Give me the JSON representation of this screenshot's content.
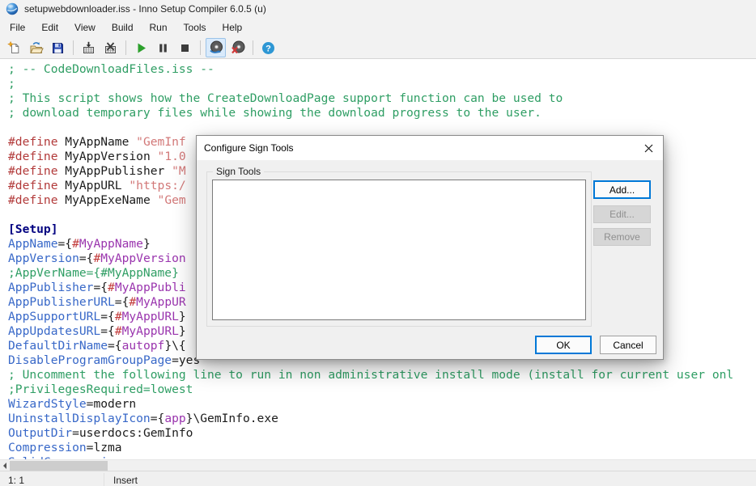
{
  "window": {
    "title": "setupwebdownloader.iss - Inno Setup Compiler 6.0.5 (u)",
    "app_icon": "inno-setup-sphere-icon"
  },
  "menubar": {
    "items": [
      "File",
      "Edit",
      "View",
      "Build",
      "Run",
      "Tools",
      "Help"
    ]
  },
  "toolbar": {
    "buttons": [
      {
        "name": "new-script",
        "icon": "new-file-icon",
        "active": false
      },
      {
        "name": "open-script",
        "icon": "open-folder-icon",
        "active": false
      },
      {
        "name": "save-script",
        "icon": "save-floppy-icon",
        "active": false
      },
      {
        "name": "compile",
        "icon": "compile-crate-icon",
        "active": false
      },
      {
        "name": "stop-compile",
        "icon": "crate-x-icon",
        "active": false
      },
      {
        "name": "run",
        "icon": "run-play-icon",
        "active": false
      },
      {
        "name": "pause",
        "icon": "pause-icon",
        "active": false
      },
      {
        "name": "terminate",
        "icon": "stop-square-icon",
        "active": false
      },
      {
        "name": "target-setup",
        "icon": "cd-arrow-icon",
        "active": true
      },
      {
        "name": "target-uninstall",
        "icon": "cd-x-icon",
        "active": false
      },
      {
        "name": "help",
        "icon": "help-question-icon",
        "active": false
      }
    ]
  },
  "editor": {
    "lines": [
      [
        [
          "cm",
          "; -- CodeDownloadFiles.iss --"
        ]
      ],
      [
        [
          "cm",
          ";"
        ]
      ],
      [
        [
          "cm",
          "; This script shows how the CreateDownloadPage support function can be used to"
        ]
      ],
      [
        [
          "cm",
          "; download temporary files while showing the download progress to the user."
        ]
      ],
      [],
      [
        [
          "dir",
          "#define"
        ],
        [
          "id",
          " MyAppName "
        ],
        [
          "str",
          "\"GemInf"
        ]
      ],
      [
        [
          "dir",
          "#define"
        ],
        [
          "id",
          " MyAppVersion "
        ],
        [
          "str",
          "\"1.0"
        ]
      ],
      [
        [
          "dir",
          "#define"
        ],
        [
          "id",
          " MyAppPublisher "
        ],
        [
          "str",
          "\"M"
        ]
      ],
      [
        [
          "dir",
          "#define"
        ],
        [
          "id",
          " MyAppURL "
        ],
        [
          "str",
          "\"https:/"
        ]
      ],
      [
        [
          "dir",
          "#define"
        ],
        [
          "id",
          " MyAppExeName "
        ],
        [
          "str",
          "\"Gem"
        ]
      ],
      [],
      [
        [
          "sec",
          "[Setup]"
        ]
      ],
      [
        [
          "kw",
          "AppName"
        ],
        [
          "sym",
          "={"
        ],
        [
          "hash",
          "#"
        ],
        [
          "const",
          "MyAppName"
        ],
        [
          "sym",
          "}"
        ]
      ],
      [
        [
          "kw",
          "AppVersion"
        ],
        [
          "sym",
          "={"
        ],
        [
          "hash",
          "#"
        ],
        [
          "const",
          "MyAppVersion"
        ]
      ],
      [
        [
          "cm",
          ";AppVerName={#MyAppName}"
        ]
      ],
      [
        [
          "kw",
          "AppPublisher"
        ],
        [
          "sym",
          "={"
        ],
        [
          "hash",
          "#"
        ],
        [
          "const",
          "MyAppPubli"
        ]
      ],
      [
        [
          "kw",
          "AppPublisherURL"
        ],
        [
          "sym",
          "={"
        ],
        [
          "hash",
          "#"
        ],
        [
          "const",
          "MyAppUR"
        ]
      ],
      [
        [
          "kw",
          "AppSupportURL"
        ],
        [
          "sym",
          "={"
        ],
        [
          "hash",
          "#"
        ],
        [
          "const",
          "MyAppURL"
        ],
        [
          "sym",
          "}"
        ]
      ],
      [
        [
          "kw",
          "AppUpdatesURL"
        ],
        [
          "sym",
          "={"
        ],
        [
          "hash",
          "#"
        ],
        [
          "const",
          "MyAppURL"
        ],
        [
          "sym",
          "}"
        ]
      ],
      [
        [
          "kw",
          "DefaultDirName"
        ],
        [
          "sym",
          "={"
        ],
        [
          "const",
          "autopf"
        ],
        [
          "sym",
          "}\\{"
        ]
      ],
      [
        [
          "kw",
          "DisableProgramGroupPage"
        ],
        [
          "sym",
          "="
        ],
        [
          "id",
          "yes"
        ]
      ],
      [
        [
          "cm",
          "; Uncomment the following line to run in non administrative install mode (install for current user onl"
        ]
      ],
      [
        [
          "cm",
          ";PrivilegesRequired=lowest"
        ]
      ],
      [
        [
          "kw",
          "WizardStyle"
        ],
        [
          "sym",
          "="
        ],
        [
          "id",
          "modern"
        ]
      ],
      [
        [
          "kw",
          "UninstallDisplayIcon"
        ],
        [
          "sym",
          "={"
        ],
        [
          "const",
          "app"
        ],
        [
          "sym",
          "}\\"
        ],
        [
          "id",
          "GemInfo.exe"
        ]
      ],
      [
        [
          "kw",
          "OutputDir"
        ],
        [
          "sym",
          "="
        ],
        [
          "id",
          "userdocs:GemInfo"
        ]
      ],
      [
        [
          "kw",
          "Compression"
        ],
        [
          "sym",
          "="
        ],
        [
          "id",
          "lzma"
        ]
      ],
      [
        [
          "kw",
          "SolidCompression"
        ],
        [
          "sym",
          "="
        ],
        [
          "id",
          "yes"
        ]
      ]
    ]
  },
  "dialog": {
    "title": "Configure Sign Tools",
    "group_label": "Sign Tools",
    "add_label": "Add...",
    "edit_label": "Edit...",
    "remove_label": "Remove",
    "ok_label": "OK",
    "cancel_label": "Cancel"
  },
  "statusbar": {
    "caret": "1: 1",
    "mode": "Insert"
  },
  "colors": {
    "accent": "#0078d7",
    "toolbar_active_bg": "#d9eafb",
    "toolbar_active_border": "#9bc3e8",
    "comment": "#2f9e64",
    "keyword": "#3868c8",
    "directive": "#b23a3a",
    "string": "#d27878",
    "constant": "#9a35ae",
    "section": "#000080"
  }
}
